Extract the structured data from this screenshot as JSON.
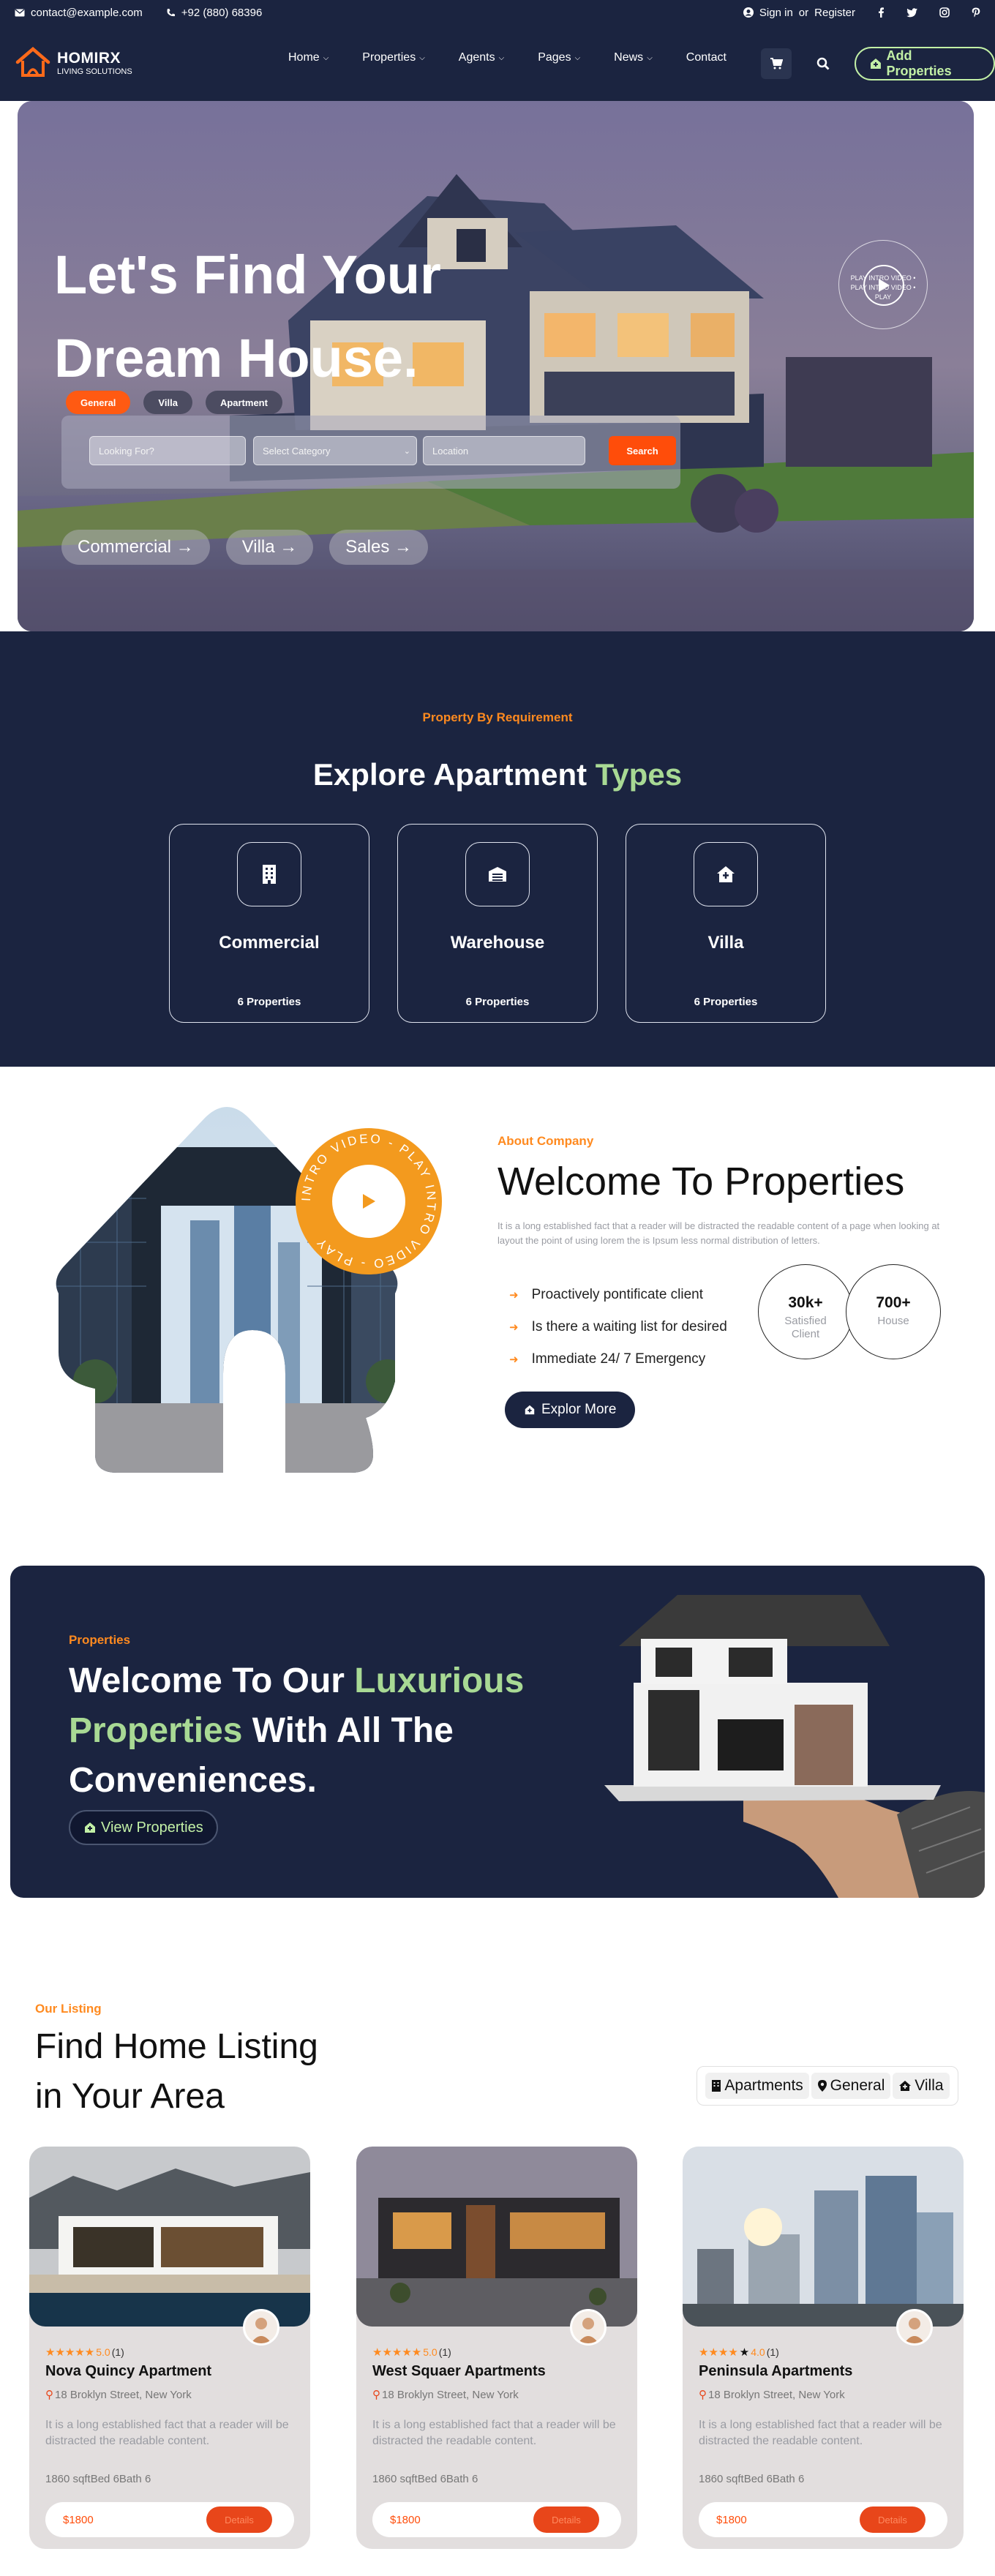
{
  "topbar": {
    "email": "contact@example.com",
    "phone": "+92 (880) 68396",
    "signin": "Sign in",
    "or": "or",
    "register": "Register"
  },
  "header": {
    "logo_name": "HOMIRX",
    "logo_tagline": "LIVING SOLUTIONS",
    "nav": [
      "Home",
      "Properties",
      "Agents",
      "Pages",
      "News",
      "Contact"
    ],
    "add_properties": "Add Properties"
  },
  "hero": {
    "title_line1": "Let's Find Your",
    "title_line2": "Dream House.",
    "tabs": [
      "General",
      "Villa",
      "Apartment"
    ],
    "search": {
      "looking_placeholder": "Looking For?",
      "category_value": "Select Category",
      "location_placeholder": "Location",
      "button": "Search"
    },
    "pills": [
      "Commercial →",
      "Villa →",
      "Sales →"
    ],
    "video_ring_text": "PLAY INTRO VIDEO • PLAY INTRO VIDEO • PLAY"
  },
  "types": {
    "kicker": "Property By Requirement",
    "title_main": "Explore Apartment ",
    "title_accent": "Types",
    "cards": [
      {
        "name": "Commercial",
        "count": "6 Properties",
        "icon": "building-icon"
      },
      {
        "name": "Warehouse",
        "count": "6 Properties",
        "icon": "warehouse-icon"
      },
      {
        "name": "Villa",
        "count": "6 Properties",
        "icon": "house-icon"
      }
    ]
  },
  "about": {
    "kicker": "About Company",
    "title": "Welcome To Properties",
    "description": "It is a long established fact that a reader will be distracted the readable content of a page when looking at layout the point of using lorem the is Ipsum less normal distribution of letters.",
    "checks": [
      "Proactively pontificate client",
      "Is there a waiting list for desired",
      "Immediate 24/ 7 Emergency"
    ],
    "stats": [
      {
        "value": "30k+",
        "label": "Satisfied Client"
      },
      {
        "value": "700+",
        "label": "House"
      }
    ],
    "button": "Explor More",
    "badge_text": "INTRO VIDEO - PLAY INTRO VIDEO - PLAY"
  },
  "lux": {
    "kicker": "Properties",
    "t1": "Welcome To Our ",
    "t2": "Luxurious",
    "t3": "Properties",
    "t4": " With All The",
    "t5": "Conveniences.",
    "button": "View Properties"
  },
  "listing": {
    "kicker": "Our Listing",
    "title_line1": "Find Home Listing",
    "title_line2": "in Your Area",
    "filters": [
      "Apartments",
      "General",
      "Villa"
    ],
    "cards": [
      {
        "stars": "★★★★★",
        "rating": "5.0",
        "reviews": "(1)",
        "name": "Nova Quincy Apartment",
        "address": "18 Broklyn Street, New York",
        "desc": "It is a long established fact that a reader will be distracted the readable content.",
        "specs": "1860 sqftBed 6Bath 6",
        "price": "$1800",
        "details": "Details"
      },
      {
        "stars": "★★★★★",
        "rating": "5.0",
        "reviews": "(1)",
        "name": "West Squaer Apartments",
        "address": "18 Broklyn Street, New York",
        "desc": "It is a long established fact that a reader will be distracted the readable content.",
        "specs": "1860 sqftBed 6Bath 6",
        "price": "$1800",
        "details": "Details"
      },
      {
        "stars": "★★★★",
        "rating": "4.0",
        "reviews": "(1)",
        "name": "Peninsula Apartments",
        "address": "18 Broklyn Street, New York",
        "desc": "It is a long established fact that a reader will be distracted the readable content.",
        "specs": "1860 sqftBed 6Bath 6",
        "price": "$1800",
        "details": "Details"
      }
    ]
  },
  "colors": {
    "navy": "#1b2440",
    "orange": "#ff5a12",
    "accent_green": "#a8d994"
  }
}
